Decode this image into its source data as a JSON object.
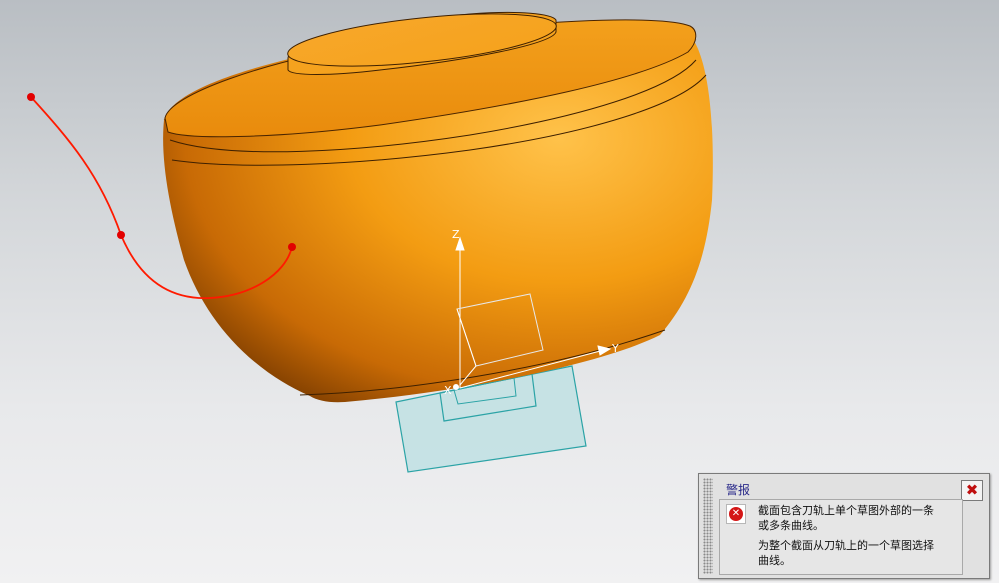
{
  "viewport": {
    "axes": {
      "z_label": "Z",
      "y_label": "Y",
      "x_label": "X"
    },
    "colors": {
      "body": "#f39c12",
      "sketch_curve": "#ff1a00",
      "sketch_plane": "#2ba3a6",
      "background_top": "#b9bec3",
      "background_bottom": "#f1f1f2"
    }
  },
  "alert": {
    "title": "警报",
    "icon": "error-icon",
    "lines": [
      "截面包含刀轨上单个草图外部的一条",
      "或多条曲线。",
      "为整个截面从刀轨上的一个草图选择",
      "曲线。"
    ],
    "close_icon": "close-icon"
  }
}
